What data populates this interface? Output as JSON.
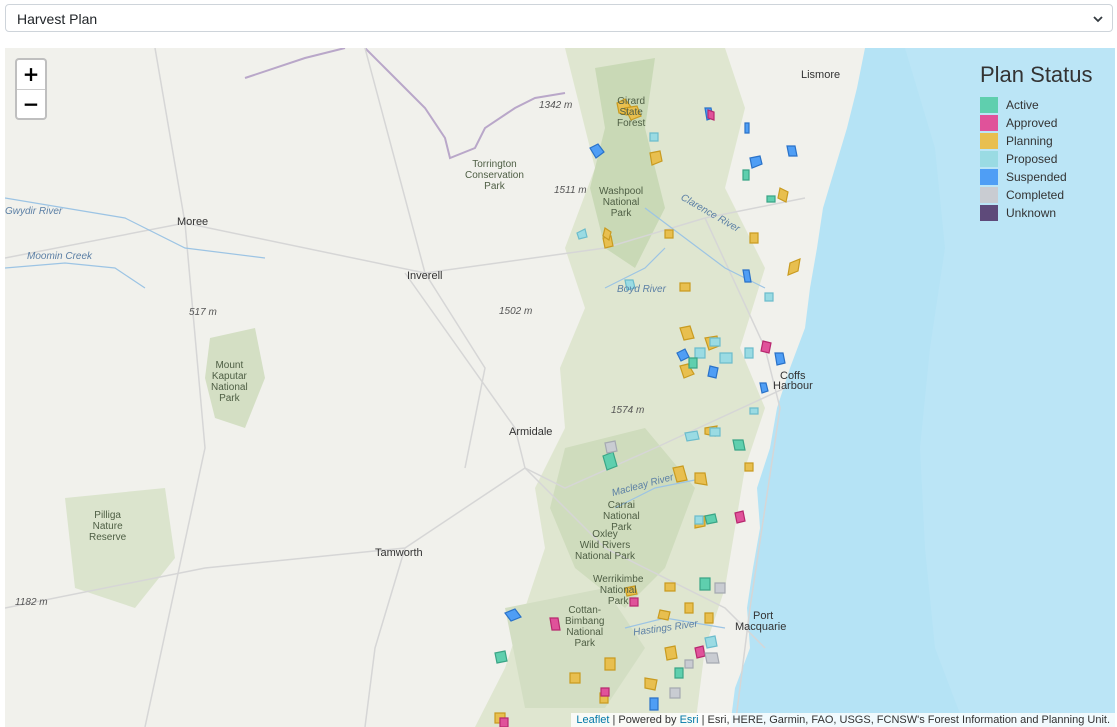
{
  "selector": {
    "value": "Harvest Plan"
  },
  "zoom": {
    "in_label": "+",
    "out_label": "−"
  },
  "legend": {
    "title": "Plan Status",
    "items": [
      {
        "label": "Active",
        "color": "#5fcfae"
      },
      {
        "label": "Approved",
        "color": "#e0529a"
      },
      {
        "label": "Planning",
        "color": "#e8bf4f"
      },
      {
        "label": "Proposed",
        "color": "#9adbe3"
      },
      {
        "label": "Suspended",
        "color": "#4f9ef5"
      },
      {
        "label": "Completed",
        "color": "#c9ccd2"
      },
      {
        "label": "Unknown",
        "color": "#5e4a7a"
      }
    ]
  },
  "attribution": {
    "leaflet": "Leaflet",
    "sep1": " | Powered by ",
    "esri": "Esri",
    "rest": " | Esri, HERE, Garmin, FAO, USGS, FCNSW's Forest Information and Planning Unit."
  },
  "places": {
    "lismore": "Lismore",
    "moree": "Moree",
    "inverell": "Inverell",
    "armidale": "Armidale",
    "tamworth": "Tamworth",
    "coffs1": "Coffs",
    "coffs2": "Harbour",
    "port1": "Port",
    "port2": "Macquarie",
    "girard": "Girard\nState\nForest",
    "torrington": "Torrington\nConservation\nPark",
    "washpool": "Washpool\nNational\nPark",
    "kaputar": "Mount\nKaputar\nNational\nPark",
    "pilliga": "Pilliga\nNature\nReserve",
    "carrai": "Carrai\nNational\nPark",
    "oxley": "Oxley\nWild Rivers\nNational Park",
    "werrikimbe": "Werrikimbe\nNational\nPark",
    "cottan": "Cottan-\nBimbang\nNational\nPark",
    "e1342": "1342 m",
    "e1511": "1511 m",
    "e517": "517 m",
    "e1502": "1502 m",
    "e1574": "1574 m",
    "e1182": "1182 m",
    "gwydir": "Gwydir River",
    "moomin": "Moomin Creek",
    "clarence": "Clarence River",
    "boyd": "Boyd River",
    "macleay": "Macleay River",
    "hastings": "Hastings River"
  }
}
